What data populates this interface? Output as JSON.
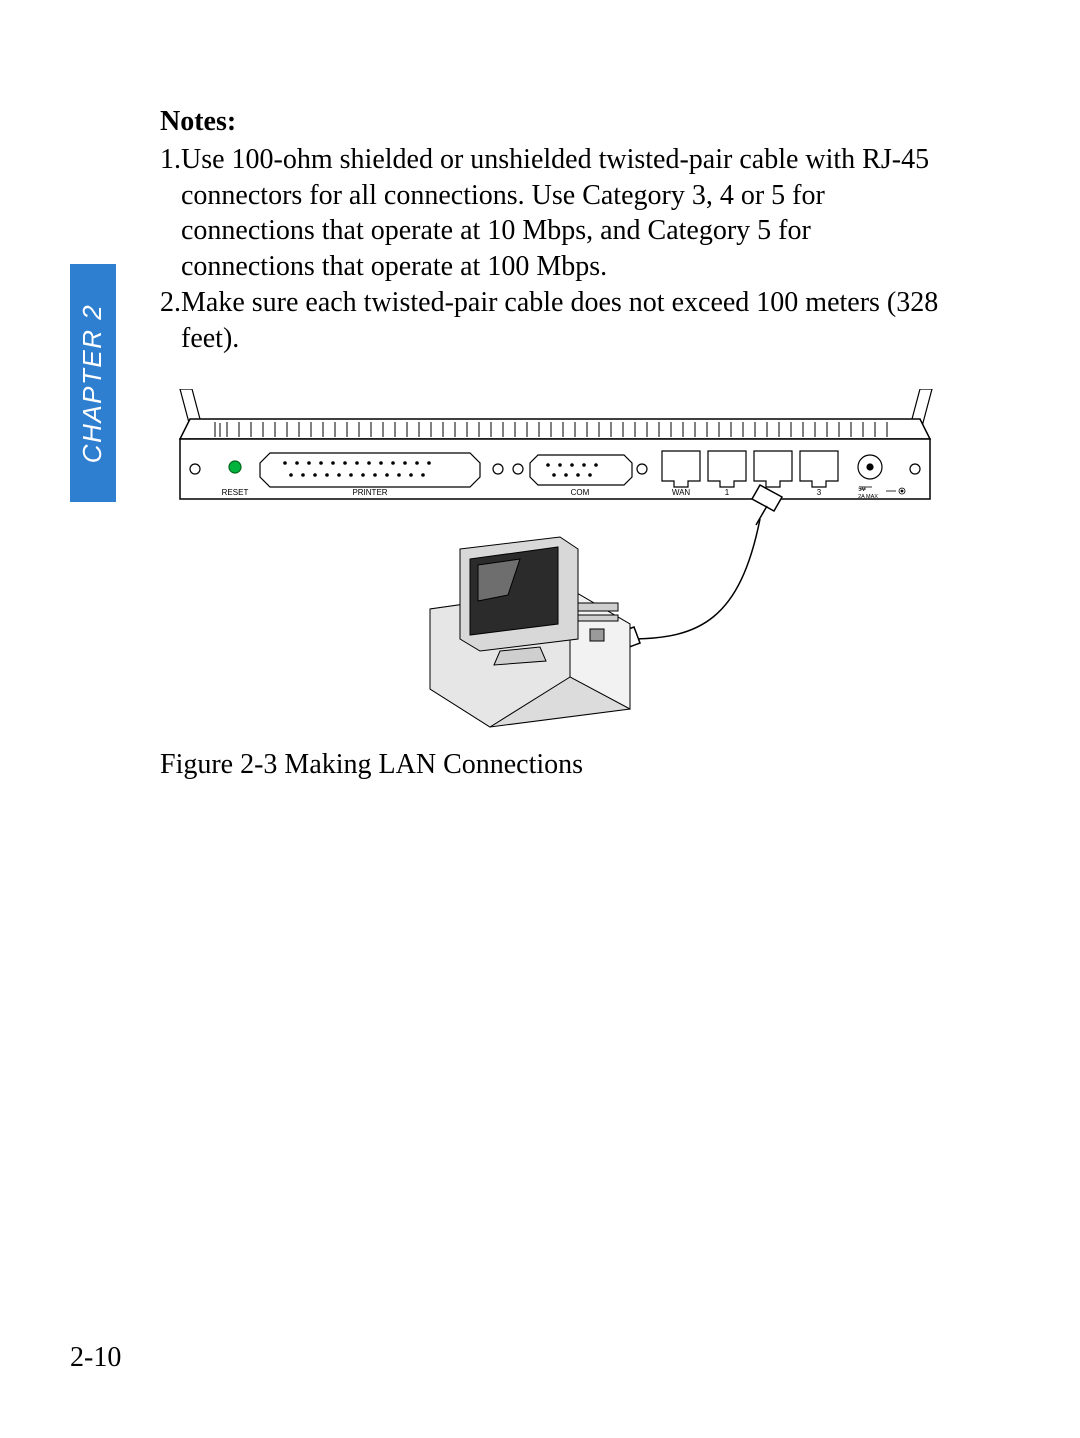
{
  "sidebar": {
    "chapter_label": "CHAPTER 2",
    "tab_color": "#2f7fd1"
  },
  "notes": {
    "heading": "Notes:",
    "items": [
      {
        "num": "1.",
        "text": "Use 100-ohm shielded or unshielded twisted-pair cable with RJ-45 connectors for all connections. Use Category 3, 4 or 5 for connections that operate at 10 Mbps, and Category 5 for connections that operate at 100 Mbps."
      },
      {
        "num": "2.",
        "text": "Make sure each twisted-pair cable does not exceed 100 meters (328 feet)."
      }
    ]
  },
  "figure": {
    "caption": "Figure 2-3 Making LAN Connections",
    "port_labels": {
      "reset": "RESET",
      "printer": "PRINTER",
      "com": "COM",
      "wan": "WAN",
      "lan1": "1",
      "lan3": "3",
      "power1": "5V",
      "power2": "2A MAX"
    }
  },
  "footer": {
    "page_number": "2-10"
  }
}
